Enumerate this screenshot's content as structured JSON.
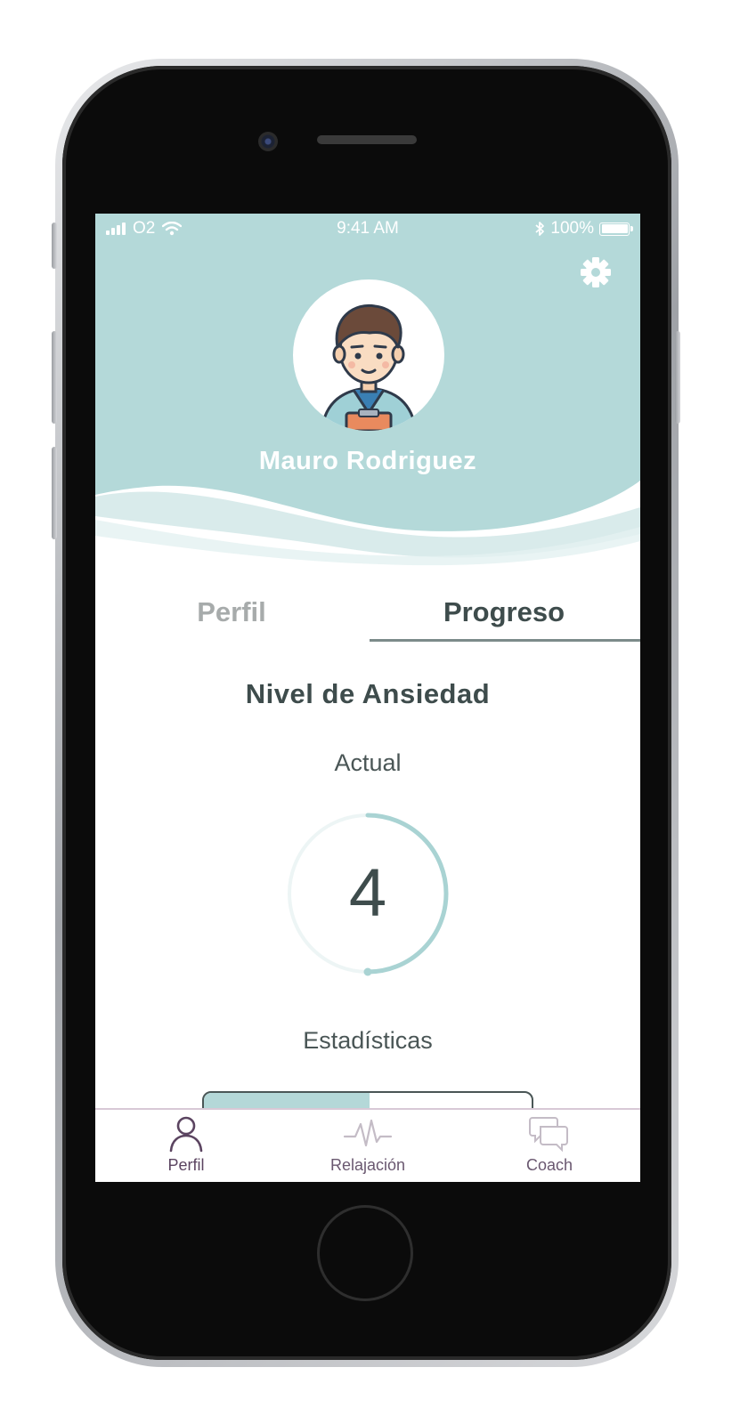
{
  "status_bar": {
    "carrier": "O2",
    "time": "9:41 AM",
    "battery": "100%"
  },
  "profile": {
    "name": "Mauro Rodriguez"
  },
  "tabs": [
    {
      "label": "Perfil",
      "active": false
    },
    {
      "label": "Progreso",
      "active": true
    }
  ],
  "progress": {
    "title": "Nivel de Ansiedad",
    "current_label": "Actual",
    "current_value": "4",
    "gauge_fraction": 0.5,
    "stats_label": "Estadísticas"
  },
  "bottom_nav": [
    {
      "label": "Perfil",
      "icon": "person-icon",
      "active": true
    },
    {
      "label": "Relajación",
      "icon": "pulse-icon",
      "active": false
    },
    {
      "label": "Coach",
      "icon": "chat-bubbles-icon",
      "active": false
    }
  ],
  "colors": {
    "header": "#b4d9d9",
    "accent": "#a9d3d3",
    "text_dark": "#3e4c4c",
    "nav_active": "#5b4460"
  }
}
